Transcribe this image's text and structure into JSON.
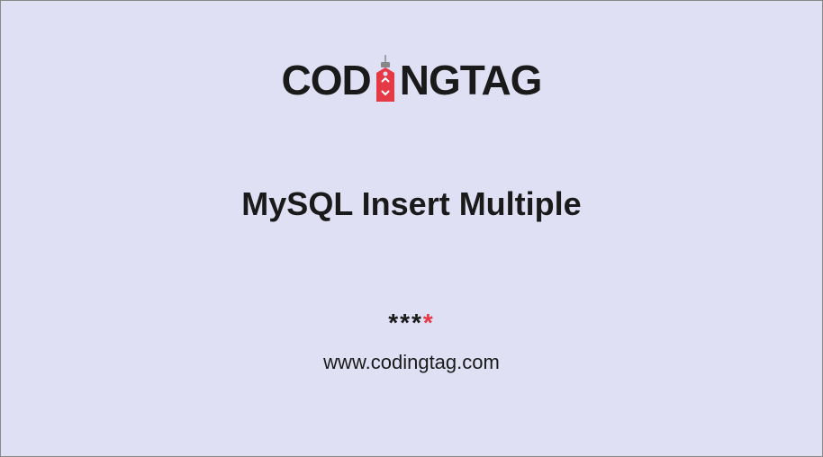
{
  "logo": {
    "text_before": "COD",
    "text_after": "NGTAG"
  },
  "title": "MySQL Insert Multiple",
  "stars": {
    "black": "***",
    "red": "*"
  },
  "url": "www.codingtag.com"
}
